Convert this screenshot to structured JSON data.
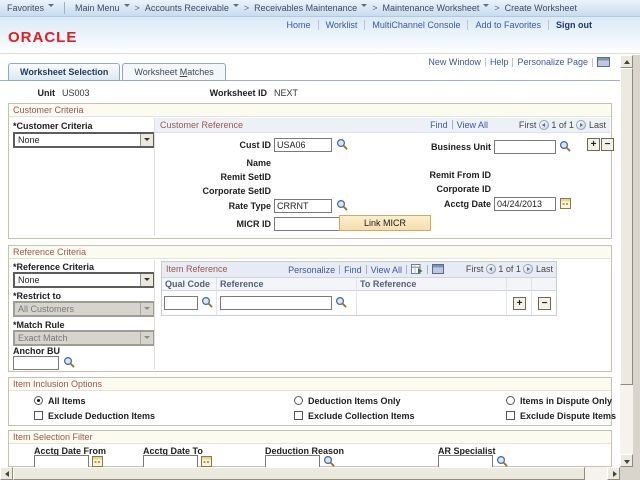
{
  "breadcrumb": {
    "favorites_label": "Favorites",
    "separator": ">",
    "items": [
      {
        "label": "Main Menu",
        "dropdown": true
      },
      {
        "label": "Accounts Receivable",
        "dropdown": true
      },
      {
        "label": "Receivables Maintenance",
        "dropdown": true
      },
      {
        "label": "Maintenance Worksheet",
        "dropdown": true
      },
      {
        "label": "Create Worksheet",
        "dropdown": false
      }
    ]
  },
  "banner": {
    "logo_text": "ORACLE",
    "links": [
      "Home",
      "Worklist",
      "MultiChannel Console",
      "Add to Favorites"
    ],
    "signout_label": "Sign out"
  },
  "pagebar": {
    "new_window": "New Window",
    "help": "Help",
    "personalize_page": "Personalize Page"
  },
  "tabs": [
    {
      "label": "Worksheet Selection",
      "active": true
    },
    {
      "label_pre": "Worksheet ",
      "label_key": "M",
      "label_rest": "atches",
      "active": false
    }
  ],
  "header_fields": {
    "unit_label": "Unit",
    "unit_value": "US003",
    "worksheet_id_label": "Worksheet ID",
    "worksheet_id_value": "NEXT"
  },
  "customer_criteria": {
    "title": "Customer Criteria",
    "criteria_label": "*Customer Criteria",
    "criteria_value": "None",
    "reference": {
      "title": "Customer Reference",
      "find": "Find",
      "view_all": "View All",
      "first": "First",
      "page_pos": "1 of 1",
      "last": "Last"
    },
    "cust_id_label": "Cust ID",
    "cust_id_value": "USA06",
    "business_unit_label": "Business Unit",
    "business_unit_value": "",
    "name_label": "Name",
    "remit_setid_label": "Remit SetID",
    "remit_from_id_label": "Remit From ID",
    "corporate_setid_label": "Corporate SetID",
    "corporate_id_label": "Corporate ID",
    "rate_type_label": "Rate Type",
    "rate_type_value": "CRRNT",
    "acctg_date_label": "Acctg Date",
    "acctg_date_value": "04/24/2013",
    "micr_id_label": "MICR ID",
    "micr_id_value": "",
    "link_micr_button": "Link MICR"
  },
  "reference_criteria": {
    "title": "Reference Criteria",
    "criteria_label": "*Reference Criteria",
    "criteria_value": "None",
    "restrict_label": "*Restrict to",
    "restrict_value": "All Customers",
    "match_rule_label": "*Match Rule",
    "match_rule_value": "Exact Match",
    "anchor_bu_label": "Anchor BU",
    "anchor_bu_value": "",
    "grid": {
      "title": "Item Reference",
      "personalize": "Personalize",
      "find": "Find",
      "view_all": "View All",
      "first": "First",
      "page_pos": "1 of 1",
      "last": "Last",
      "columns": [
        "Qual Code",
        "Reference",
        "To Reference"
      ],
      "row": {
        "qual_code": "",
        "reference": "",
        "to_reference": ""
      }
    }
  },
  "item_inclusion": {
    "title": "Item Inclusion Options",
    "radios": [
      {
        "label": "All Items",
        "selected": true
      },
      {
        "label": "Deduction Items Only",
        "selected": false
      },
      {
        "label": "Items in Dispute Only",
        "selected": false
      }
    ],
    "checkboxes": [
      {
        "label": "Exclude Deduction Items",
        "checked": false
      },
      {
        "label": "Exclude Collection Items",
        "checked": false
      },
      {
        "label": "Exclude Dispute Items",
        "checked": false
      }
    ]
  },
  "item_selection_filter": {
    "title": "Item Selection Filter",
    "fields": [
      {
        "label": "Acctg Date From",
        "value": "",
        "icon": "calendar"
      },
      {
        "label": "Acctg Date To",
        "value": "",
        "icon": "calendar"
      },
      {
        "label": "Deduction Reason",
        "value": "",
        "icon": "lookup"
      },
      {
        "label": "AR Specialist",
        "value": "",
        "icon": "lookup"
      }
    ]
  },
  "icons": {
    "lookup": "magnifier",
    "calendar": "calendar-grid",
    "dropdown": "down-triangle",
    "add_row": "plus",
    "delete_row": "minus",
    "prev_page": "left-arrow-circle",
    "next_page": "right-arrow-circle",
    "download_grid": "spreadsheet-export",
    "grid_popout": "grid-window",
    "copy_url": "grid-window"
  },
  "colors": {
    "oracle_red": "#e21d22",
    "link_blue": "#3a57a2",
    "section_title": "#9a564a",
    "button_face": "#f8e0b4",
    "banner_blue": "#d9e9f7"
  }
}
